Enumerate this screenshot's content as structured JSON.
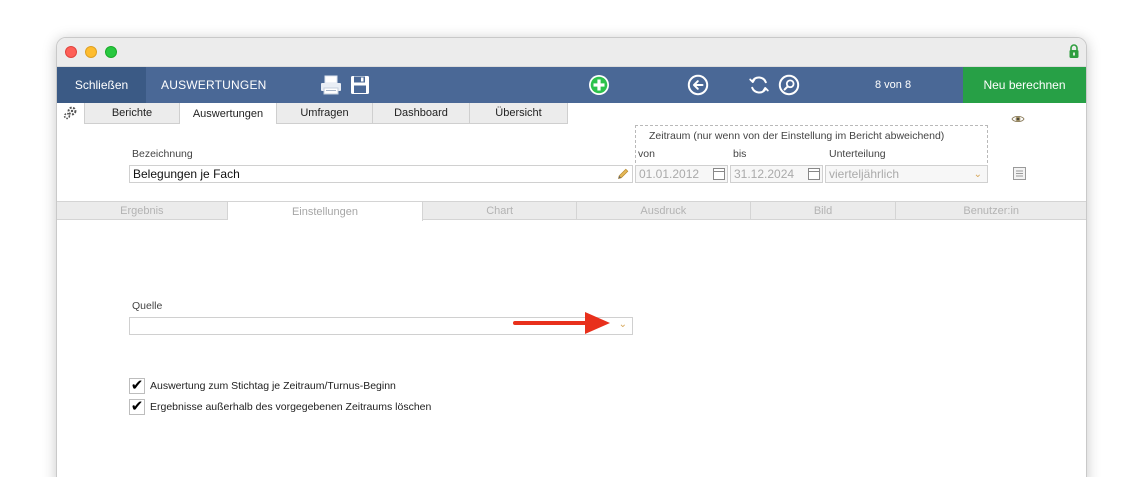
{
  "toolbar": {
    "close_label": "Schließen",
    "title": "AUSWERTUNGEN",
    "record_count": "8 von 8",
    "recalc_label": "Neu berechnen",
    "icons": [
      "printer-icon",
      "save-icon",
      "add-icon",
      "back-icon",
      "refresh-icon",
      "search-icon"
    ],
    "add_color": "#2dc24c",
    "recalc_color": "#27a046",
    "bar_color": "#4a6896"
  },
  "top_tabs": [
    {
      "label": "Berichte",
      "active": false
    },
    {
      "label": "Auswertungen",
      "active": true
    },
    {
      "label": "Umfragen",
      "active": false
    },
    {
      "label": "Dashboard",
      "active": false
    },
    {
      "label": "Übersicht",
      "active": false
    }
  ],
  "form": {
    "bezeichnung_label": "Bezeichnung",
    "bezeichnung_value": "Belegungen je Fach",
    "zeitraum_title": "Zeitraum (nur wenn von der Einstellung im Bericht abweichend)",
    "von_label": "von",
    "von_value": "01.01.2012",
    "bis_label": "bis",
    "bis_value": "31.12.2024",
    "unterteilung_label": "Unterteilung",
    "unterteilung_value": "vierteljährlich"
  },
  "sub_tabs": [
    {
      "label": "Ergebnis",
      "active": false
    },
    {
      "label": "Einstellungen",
      "active": true
    },
    {
      "label": "Chart",
      "active": false
    },
    {
      "label": "Ausdruck",
      "active": false
    },
    {
      "label": "Bild",
      "active": false
    },
    {
      "label": "Benutzer:in",
      "active": false
    }
  ],
  "settings": {
    "quelle_label": "Quelle",
    "quelle_value": "",
    "checks": [
      {
        "label": "Auswertung zum Stichtag je Zeitraum/Turnus-Beginn",
        "checked": true,
        "mark": "✔"
      },
      {
        "label": "Ergebnisse außerhalb des vorgegebenen Zeitraums löschen",
        "checked": true,
        "mark": "✔"
      }
    ]
  },
  "annotation": {
    "arrow_color": "#e8301c"
  }
}
